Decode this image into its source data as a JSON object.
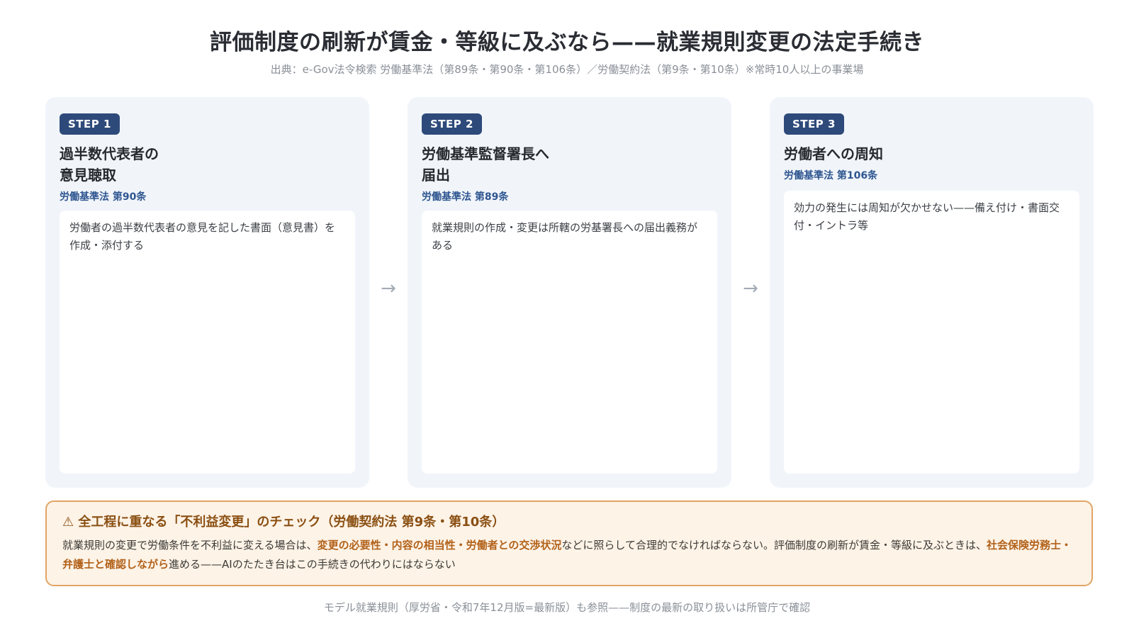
{
  "header": {
    "title": "評価制度の刷新が賃金・等級に及ぶなら——就業規則変更の法定手続き",
    "subtitle": "出典：e-Gov法令検索 労働基準法（第89条・第90条・第106条）／労働契約法（第9条・第10条）※常時10人以上の事業場"
  },
  "steps": [
    {
      "badge": "STEP 1",
      "title": "過半数代表者の\n意見聴取",
      "law": "労働基準法 第90条",
      "body": "労働者の過半数代表者の意見を記した書面（意見書）を作成・添付する"
    },
    {
      "badge": "STEP 2",
      "title": "労働基準監督署長へ\n届出",
      "law": "労働基準法 第89条",
      "body": "就業規則の作成・変更は所轄の労基署長への届出義務がある"
    },
    {
      "badge": "STEP 3",
      "title": "労働者への周知",
      "law": "労働基準法 第106条",
      "body": "効力の発生には周知が欠かせない——備え付け・書面交付・イントラ等"
    }
  ],
  "arrows": [
    "→",
    "→"
  ],
  "warning": {
    "icon": "⚠",
    "title": "全工程に重なる「不利益変更」のチェック（労働契約法 第9条・第10条）",
    "text_1": "就業規則の変更で労働条件を不利益に変える場合は、",
    "highlight_1": "変更の必要性・内容の相当性・労働者との交渉状況",
    "text_2": "などに照らして合理的でなければならない。評価制度の刷新が賃金・等級に及ぶときは、",
    "highlight_2": "社会保険労務士・弁護士と確認しながら",
    "text_3": "進める——AIのたたき台はこの手続きの代わりにはならない"
  },
  "footer": "モデル就業規則（厚労省・令和7年12月版=最新版）も参照——制度の最新の取り扱いは所管庁で確認",
  "colors": {
    "badge": "#2e4a7a",
    "law": "#2e5590",
    "step_bg": "#f1f5fa",
    "warning_bg": "#fdf3e7",
    "warning_border": "#e1a565",
    "highlight": "#b2621a"
  }
}
